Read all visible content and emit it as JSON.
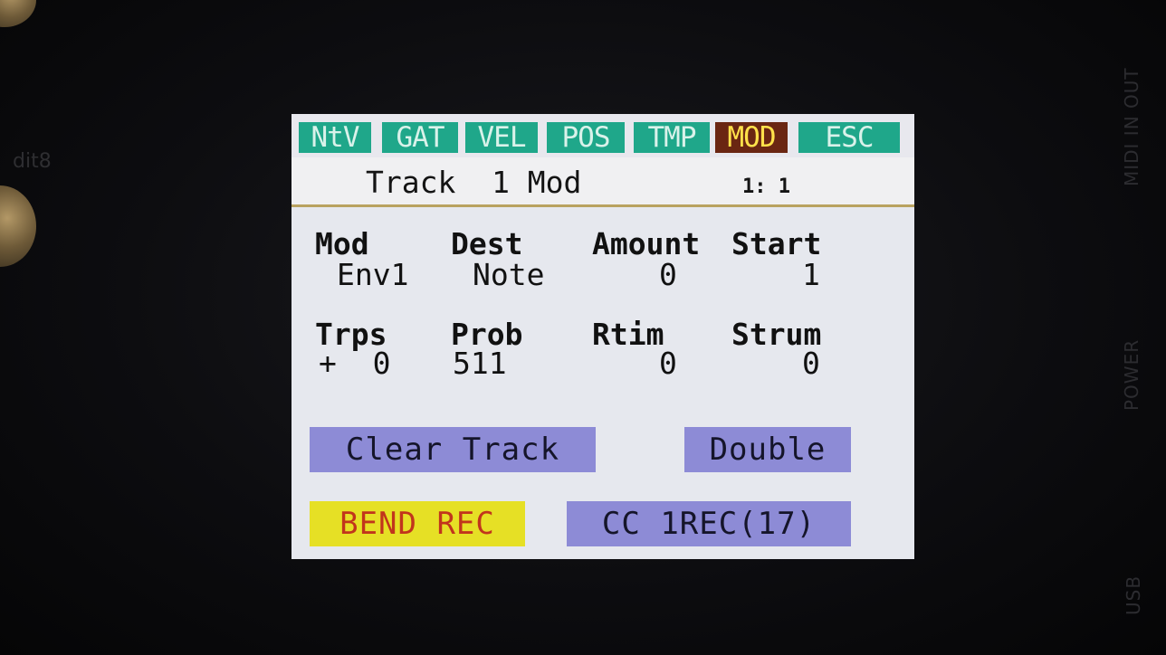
{
  "bezel": {
    "midi_label": "MIDI IN  OUT",
    "power_label": "POWER",
    "usb_label": "USB",
    "left_label": "dit8"
  },
  "tabs": [
    {
      "label": "NtV",
      "active": false
    },
    {
      "label": "GAT",
      "active": false
    },
    {
      "label": "VEL",
      "active": false
    },
    {
      "label": "POS",
      "active": false
    },
    {
      "label": "TMP",
      "active": false
    },
    {
      "label": "MOD",
      "active": true
    },
    {
      "label": "ESC",
      "active": false
    }
  ],
  "header": {
    "title": "Track  1 Mod",
    "position": "1: 1"
  },
  "params": {
    "row1": [
      {
        "label": "Mod",
        "value": "Env1"
      },
      {
        "label": "Dest",
        "value": "Note"
      },
      {
        "label": "Amount",
        "value": "0"
      },
      {
        "label": "Start",
        "value": "1"
      }
    ],
    "row2": [
      {
        "label": "Trps",
        "value": "+  0"
      },
      {
        "label": "Prob",
        "value": "511"
      },
      {
        "label": "Rtim",
        "value": "0"
      },
      {
        "label": "Strum",
        "value": "0"
      }
    ]
  },
  "buttons": {
    "clear_track": "Clear Track",
    "double": "Double",
    "bend_rec": "BEND REC",
    "cc_rec": "CC  1REC(17)"
  },
  "colors": {
    "tab_bg": "#1fa78a",
    "tab_active_bg": "#6a2612",
    "tab_active_text": "#ffe14a",
    "button_bg": "#8d8bd6",
    "bend_bg": "#e6e025",
    "bend_text": "#c1351c",
    "screen_bg": "#e6e8ee"
  }
}
